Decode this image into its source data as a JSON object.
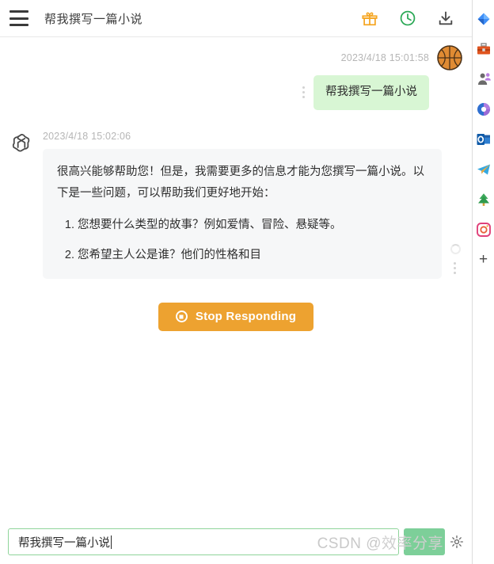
{
  "header": {
    "menu_icon": "hamburger-menu-icon",
    "title": "帮我撰写一篇小说",
    "actions": [
      {
        "name": "gift-icon",
        "label": "礼物",
        "color": "#f5a623"
      },
      {
        "name": "history-clock-icon",
        "label": "历史记录",
        "color": "#2aa855"
      },
      {
        "name": "download-icon",
        "label": "下载",
        "color": "#4a4a4a"
      }
    ]
  },
  "conversation": {
    "user_message": {
      "timestamp": "2023/4/18 15:01:58",
      "text": "帮我撰写一篇小说",
      "avatar": "basketball-avatar",
      "bubble_color": "#d8f6d4"
    },
    "assistant_message": {
      "timestamp": "2023/4/18 15:02:06",
      "avatar": "openai-logo-avatar",
      "bubble_color": "#f6f7f8",
      "paragraph": "很高兴能够帮助您！但是，我需要更多的信息才能为您撰写一篇小说。以下是一些问题，可以帮助我们更好地开始：",
      "list_items": [
        "您想要什么类型的故事？例如爱情、冒险、悬疑等。",
        "您希望主人公是谁？他们的性格和目"
      ],
      "is_streaming": true
    }
  },
  "stop_button": {
    "label": "Stop Responding",
    "color": "#eda230",
    "icon": "stop-record-icon"
  },
  "composer": {
    "input_value": "帮我撰写一篇小说",
    "input_placeholder": "",
    "send_label": "",
    "send_color": "#7dcf99",
    "settings_icon": "gear-icon"
  },
  "dock": {
    "items": [
      {
        "name": "dock-item-diamond",
        "label": "蓝色钻石"
      },
      {
        "name": "dock-item-toolbox",
        "label": "工具箱"
      },
      {
        "name": "dock-item-person",
        "label": "联系人"
      },
      {
        "name": "dock-item-copilot",
        "label": "Copilot"
      },
      {
        "name": "dock-item-outlook",
        "label": "Outlook"
      },
      {
        "name": "dock-item-telegram",
        "label": "Telegram"
      },
      {
        "name": "dock-item-tree",
        "label": "绿树"
      },
      {
        "name": "dock-item-instagram",
        "label": "Instagram"
      }
    ],
    "add_label": "+"
  },
  "watermark": {
    "prefix": "CSDN @",
    "author": "效率分享"
  }
}
